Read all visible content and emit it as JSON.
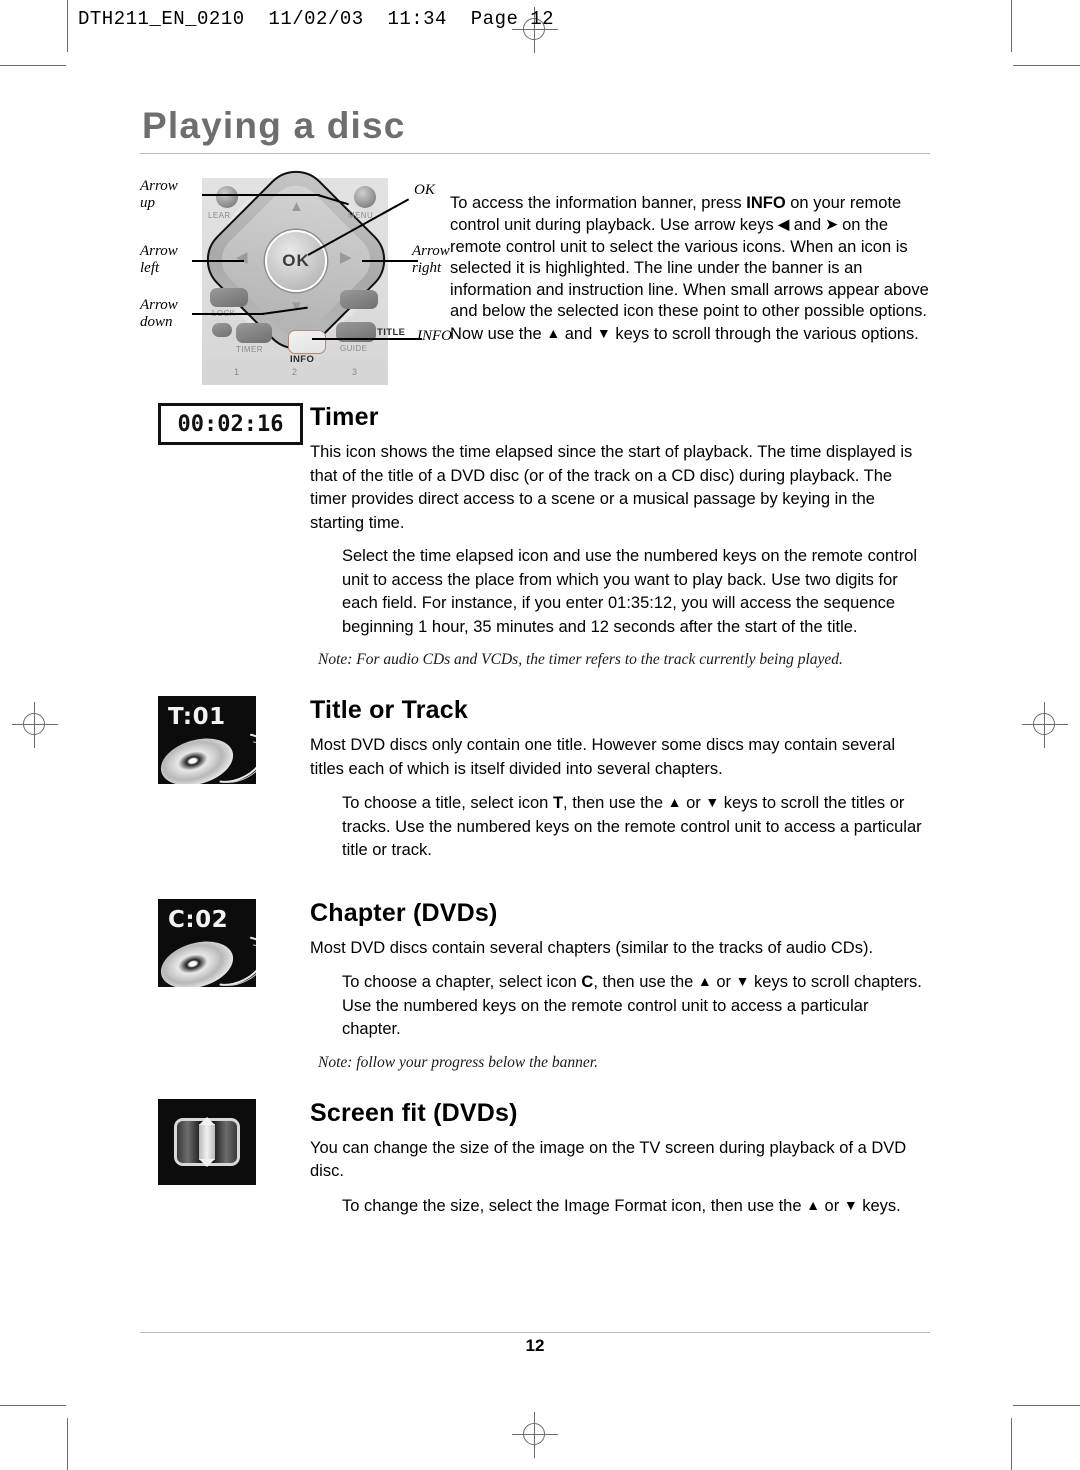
{
  "slug": "DTH211_EN_0210  11/02/03  11:34  Page 12",
  "page_title": "Playing a disc",
  "remote": {
    "ok_label": "OK",
    "buttons": [
      {
        "name": "clear",
        "label": "LEAR"
      },
      {
        "name": "menu",
        "label": "MENU"
      },
      {
        "name": "lock",
        "label": "LOCK"
      },
      {
        "name": "timer",
        "label": "TIMER"
      },
      {
        "name": "info",
        "label": "INFO"
      },
      {
        "name": "guide",
        "label": "GUIDE"
      },
      {
        "name": "title",
        "label": "TITLE"
      }
    ],
    "numbers": [
      "1",
      "2",
      "3"
    ],
    "callouts": {
      "arrow_up": "Arrow\nup",
      "arrow_left": "Arrow\nleft",
      "arrow_down": "Arrow\ndown",
      "ok": "OK",
      "arrow_right": "Arrow\nright",
      "info": "INFO"
    }
  },
  "intro": {
    "part1": "To access the information banner, press ",
    "info_kbd": "INFO",
    "part2": " on your remote control unit during playback. Use arrow keys ",
    "arrow_left_glyph": "◀",
    "part3": " and ",
    "arrow_right_glyph": "➤",
    "part4": " on the remote control unit to select the various icons. When an icon is selected it is highlighted. The line under the banner is an information and instruction line. When small arrows appear above and below the selected icon these point to other possible options. Now use the ",
    "arrow_up_glyph": "▲",
    "part5": " and ",
    "arrow_down_glyph": "▼",
    "part6": " keys to scroll through the various options."
  },
  "sections": [
    {
      "id": "timer",
      "icon_type": "timer",
      "icon_text": "00:02:16",
      "title": "Timer",
      "body": "This icon shows the time elapsed since the start of playback. The time displayed is that of the title of a DVD disc (or of the track on a CD disc) during playback. The timer provides direct access to a scene or a musical passage by keying in the starting time.",
      "indented": "Select the time elapsed icon and use the numbered keys on the remote control unit to access the place from which you want to play back. Use two digits for each field. For instance, if you enter 01:35:12, you will access the sequence beginning 1 hour, 35 minutes and 12 seconds after the start of the title.",
      "note": "Note: For audio CDs and VCDs, the timer refers to the track currently being played."
    },
    {
      "id": "title-or-track",
      "icon_type": "disc",
      "icon_text": "T:01",
      "title": "Title or Track",
      "body": "Most DVD discs only contain one title. However some discs may contain several titles each of which is itself divided into several chapters.",
      "indented_pre": "To choose a title, select icon ",
      "indented_kbd": "T",
      "indented_mid": ", then use the ",
      "indented_post": " keys to scroll the titles or tracks. Use the numbered keys on the remote control unit to access a particular title or track.",
      "note": ""
    },
    {
      "id": "chapter",
      "icon_type": "disc",
      "icon_text": "C:02",
      "title": "Chapter (DVDs)",
      "body": "Most DVD discs contain several chapters (similar to the tracks of audio CDs).",
      "indented_pre": "To choose a chapter, select icon ",
      "indented_kbd": "C",
      "indented_mid": ", then use the ",
      "indented_post": " keys to scroll chapters. Use the numbered keys on the remote control unit to access a particular chapter.",
      "note": "Note: follow your progress below the banner."
    },
    {
      "id": "screen-fit",
      "icon_type": "fit",
      "icon_text": "",
      "title": "Screen fit (DVDs)",
      "body": "You can change the size of the image on the TV screen during playback of a DVD disc.",
      "indented_pre": "To change the size, select the Image Format icon, then use the ",
      "indented_post": " keys.",
      "note": ""
    }
  ],
  "glyphs": {
    "up": "▲",
    "down": "▼",
    "or": " or "
  },
  "folio": "12",
  "colors": {
    "title_gray": "#6e6e6e",
    "rule_gray": "#b9b9b9",
    "icon_black": "#0c0c0c",
    "remote_body": "#dcdcdc"
  }
}
